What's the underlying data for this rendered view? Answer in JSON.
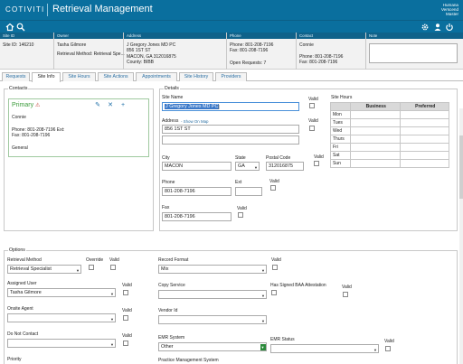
{
  "header": {
    "brand": "COTIVITI",
    "app_title": "Retrieval Management",
    "account_lines": [
      "Humana",
      "Verscend",
      "Master"
    ]
  },
  "toolbar": {
    "icons": [
      "home-icon",
      "search-icon",
      "gear-icon",
      "user-icon",
      "power-icon"
    ]
  },
  "info_bar": {
    "headers": [
      "Site ID",
      "Owner",
      "Address",
      "Phone",
      "Contact",
      "Note"
    ],
    "site_id": "Site ID: 146210",
    "owner_name": "Tasha Gilmore",
    "retrieval_method": "Retrieval Method: Retrieval Spe...",
    "address_lines": [
      "J Gregory Jones MD PC",
      "856 1ST ST",
      "MACON, GA 312016875",
      "County: BIBB"
    ],
    "phone": "Phone: 801-208-7196",
    "fax": "Fax: 801-208-7196",
    "open_requests": "Open Requests: 7",
    "contact_name": "Connie",
    "contact_phone": "Phone: 801-208-7196",
    "contact_fax": "Fax: 801-208-7196"
  },
  "tabs": [
    "Requests",
    "Site Info",
    "Site Hours",
    "Site Actions",
    "Appointments",
    "Site History",
    "Providers"
  ],
  "active_tab": "Site Info",
  "contacts": {
    "legend": "Contacts",
    "primary_label": "Primary",
    "name": "Connie",
    "phone": "Phone: 801-208-7196 Ext:",
    "fax": "Fax: 801-208-7196",
    "type": "General"
  },
  "details": {
    "legend": "Details",
    "site_name_label": "Site Name",
    "site_name_value": "J Gregory Jones MD PC",
    "valid_label": "Valid",
    "address_label": "Address",
    "show_on_map": "- Show On Map",
    "address_value": "856 1ST ST",
    "address2_value": "",
    "city_label": "City",
    "city_value": "MACON",
    "state_label": "State",
    "state_value": "GA",
    "postal_label": "Postal Code",
    "postal_value": "312016875",
    "phone_label": "Phone",
    "phone_value": "801-208-7196",
    "ext_label": "Ext",
    "ext_value": "",
    "fax_label": "Fax",
    "fax_value": "801-208-7196"
  },
  "site_hours": {
    "title": "Site Hours",
    "columns": [
      "Business",
      "Preferred"
    ],
    "days": [
      "Mon",
      "Tues",
      "Wed",
      "Thurs",
      "Fri",
      "Sat",
      "Sun"
    ]
  },
  "options": {
    "legend": "Options",
    "retrieval_method_label": "Retrieval Method",
    "retrieval_method_value": "Retrieval Specialist",
    "override_label": "Override",
    "valid_label": "Valid",
    "assigned_user_label": "Assigned User",
    "assigned_user_value": "Tasha Gilmore",
    "onsite_agent_label": "Onsite Agent",
    "do_not_contact_label": "Do Not Contact",
    "priority_label": "Priority",
    "record_format_label": "Record Format",
    "record_format_value": "Mix",
    "copy_service_label": "Copy Service",
    "vendor_id_label": "Vendor Id",
    "emr_system_label": "EMR System",
    "emr_system_value": "Other",
    "practice_mgmt_label": "Practice Management System",
    "baa_label": "Has Signed BAA Attestation",
    "emr_status_label": "EMR Status"
  },
  "colors": {
    "header_blue": "#0a6f9e",
    "primary_green": "#3b9b3b",
    "link_blue": "#2a6fa3",
    "selection_blue": "#3b79c9"
  }
}
